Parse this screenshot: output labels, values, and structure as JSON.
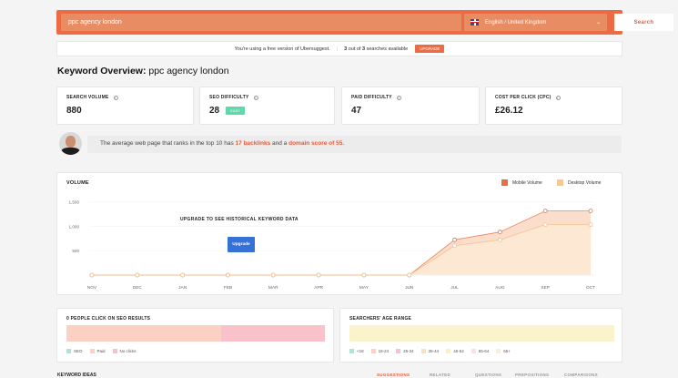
{
  "search": {
    "value": "ppc agency london",
    "button": "Search"
  },
  "language": {
    "selected": "English / United Kingdom"
  },
  "notice": {
    "text": "You're using a free version of Ubersuggest.",
    "used": "3",
    "of_word": "out of",
    "total": "3",
    "suffix": "searches available",
    "upgrade": "UPGRADE"
  },
  "overview": {
    "label": "Keyword Overview:",
    "keyword": "ppc agency london"
  },
  "metrics": {
    "search_volume": {
      "label": "SEARCH VOLUME",
      "value": "880"
    },
    "seo_difficulty": {
      "label": "SEO DIFFICULTY",
      "value": "28",
      "badge": "EASY"
    },
    "paid_difficulty": {
      "label": "PAID DIFFICULTY",
      "value": "47"
    },
    "cpc": {
      "label": "COST PER CLICK (CPC)",
      "value": "£26.12"
    }
  },
  "insight": {
    "prefix": "The average web page that ranks in the top 10 has",
    "backlinks": "17 backlinks",
    "middle": "and a",
    "domain": "domain score of 55."
  },
  "volume_chart": {
    "title": "VOLUME",
    "legend_mobile": "Mobile Volume",
    "legend_desktop": "Desktop Volume",
    "upgrade_text": "UPGRADE TO SEE HISTORICAL KEYWORD DATA",
    "upgrade_button": "Upgrade"
  },
  "chart_data": {
    "type": "area",
    "categories": [
      "NOV",
      "DEC",
      "JAN",
      "FEB",
      "MAR",
      "APR",
      "MAY",
      "JUN",
      "JUL",
      "AUG",
      "SEP",
      "OCT"
    ],
    "y_ticks": [
      "1,500",
      "1,000",
      "500"
    ],
    "ylim": [
      0,
      1600
    ],
    "series": [
      {
        "name": "Mobile Volume",
        "color": "#ec6b43",
        "values": [
          0,
          0,
          0,
          0,
          0,
          0,
          0,
          0,
          720,
          880,
          1310,
          1310
        ]
      },
      {
        "name": "Desktop Volume",
        "color": "#f8c98f",
        "values": [
          0,
          0,
          0,
          0,
          0,
          0,
          0,
          0,
          600,
          720,
          1030,
          1030
        ]
      }
    ]
  },
  "clicks_card": {
    "title": "0 PEOPLE CLICK ON SEO RESULTS",
    "bar": [
      {
        "label": "SEO",
        "color": "#a9e5d9",
        "value": 0
      },
      {
        "label": "Paid",
        "color": "#fad1c3",
        "value": 0.6
      },
      {
        "label": "No clicks",
        "color": "#f9c1c9",
        "value": 0.4
      }
    ]
  },
  "age_card": {
    "title": "SEARCHERS' AGE RANGE",
    "ranges": [
      {
        "label": "<18",
        "color": "#a9e5d9"
      },
      {
        "label": "18-24",
        "color": "#fad1c3"
      },
      {
        "label": "25-34",
        "color": "#f9c1c9"
      },
      {
        "label": "35-44",
        "color": "#fae3b5"
      },
      {
        "label": "45-54",
        "color": "#f9eec4"
      },
      {
        "label": "55-64",
        "color": "#f2e3ee"
      },
      {
        "label": "65+",
        "color": "#f8f0d0"
      }
    ]
  },
  "keyword_ideas": {
    "title": "KEYWORD IDEAS",
    "tabs": [
      "SUGGESTIONS",
      "RELATED",
      "QUESTIONS",
      "PREPOSITIONS",
      "COMPARISONS"
    ]
  }
}
